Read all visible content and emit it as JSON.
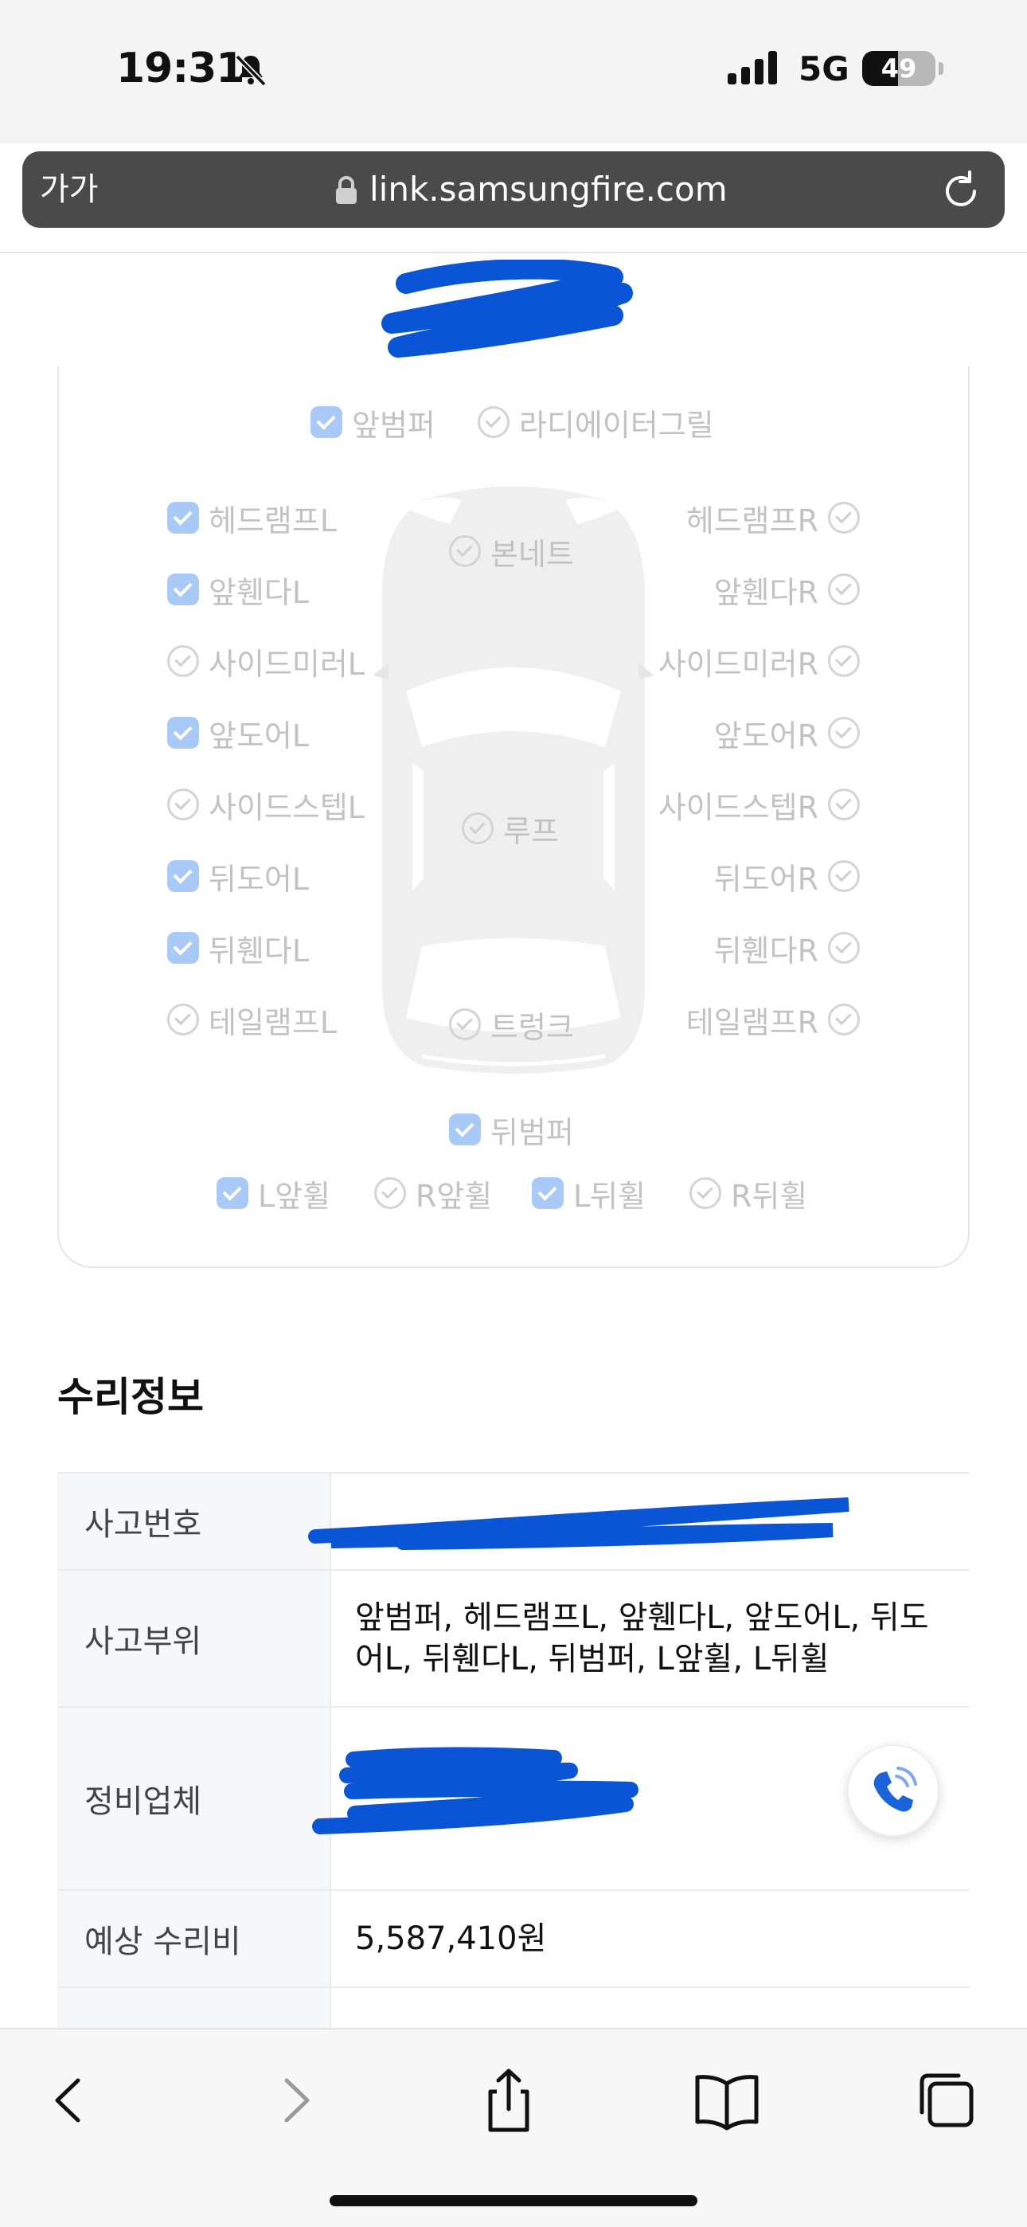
{
  "status_bar": {
    "time": "19:31",
    "network": "5G",
    "battery_level": "49",
    "battery_fraction": 0.49,
    "icons": [
      "bell-slash-icon",
      "signal-bars-icon",
      "battery-icon"
    ]
  },
  "browser": {
    "text_size_label": "가가",
    "url": "link.samsungfire.com",
    "icons": [
      "lock-icon",
      "reload-icon"
    ]
  },
  "damage_diagram": {
    "front": [
      {
        "label": "앞범퍼",
        "checked": true
      },
      {
        "label": "라디에이터그릴",
        "checked": false
      }
    ],
    "center": [
      {
        "label": "본네트",
        "checked": false
      },
      {
        "label": "루프",
        "checked": false
      },
      {
        "label": "트렁크",
        "checked": false
      }
    ],
    "left_side": [
      {
        "label": "헤드램프L",
        "checked": true
      },
      {
        "label": "앞휀다L",
        "checked": true
      },
      {
        "label": "사이드미러L",
        "checked": false
      },
      {
        "label": "앞도어L",
        "checked": true
      },
      {
        "label": "사이드스텝L",
        "checked": false
      },
      {
        "label": "뒤도어L",
        "checked": true
      },
      {
        "label": "뒤휀다L",
        "checked": true
      },
      {
        "label": "테일램프L",
        "checked": false
      }
    ],
    "right_side": [
      {
        "label": "헤드램프R",
        "checked": false
      },
      {
        "label": "앞휀다R",
        "checked": false
      },
      {
        "label": "사이드미러R",
        "checked": false
      },
      {
        "label": "앞도어R",
        "checked": false
      },
      {
        "label": "사이드스텝R",
        "checked": false
      },
      {
        "label": "뒤도어R",
        "checked": false
      },
      {
        "label": "뒤휀다R",
        "checked": false
      },
      {
        "label": "테일램프R",
        "checked": false
      }
    ],
    "rear": {
      "label": "뒤범퍼",
      "checked": true
    },
    "wheels": [
      {
        "label": "L앞휠",
        "checked": true
      },
      {
        "label": "R앞휠",
        "checked": false
      },
      {
        "label": "L뒤휠",
        "checked": true
      },
      {
        "label": "R뒤휠",
        "checked": false
      }
    ],
    "colors": {
      "checked": "#a9c9f7",
      "unchecked_border": "#d4d4d4",
      "label": "#c2c2c2"
    }
  },
  "repair_info": {
    "title": "수리정보",
    "rows": [
      {
        "label": "사고번호",
        "value": ""
      },
      {
        "label": "사고부위",
        "value": "앞범퍼, 헤드램프L, 앞휀다L, 앞도어L, 뒤도어L, 뒤휀다L, 뒤범퍼, L앞휠, L뒤휠"
      },
      {
        "label": "정비업체",
        "value": ""
      },
      {
        "label": "예상 수리비",
        "value": "5,587,410원"
      }
    ],
    "redaction_color": "#0a55d6"
  },
  "toolbar": {
    "icons": [
      "back-icon",
      "forward-icon",
      "share-icon",
      "bookmarks-icon",
      "tabs-icon"
    ]
  }
}
